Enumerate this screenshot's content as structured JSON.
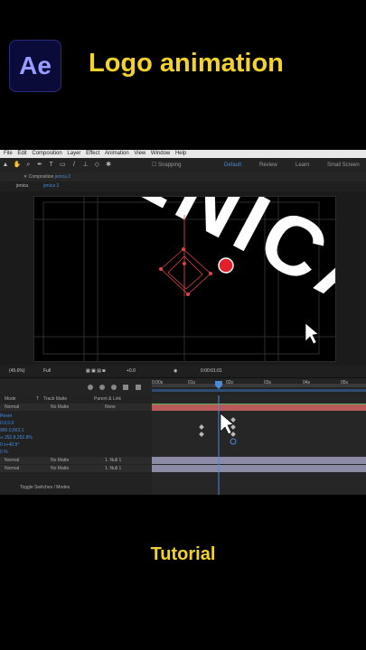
{
  "header": {
    "logo_text": "Ae",
    "title": "Logo animation"
  },
  "footer": {
    "label": "Tutorial"
  },
  "menu": [
    "File",
    "Edit",
    "Composition",
    "Layer",
    "Effect",
    "Animation",
    "View",
    "Window",
    "Help"
  ],
  "workspace": {
    "snapping": "Snapping",
    "default": "Default",
    "review": "Review",
    "learn": "Learn",
    "small_screen": "Small Screen"
  },
  "panel": {
    "title": "Composition",
    "comp_name": "jenica 2"
  },
  "tabs": [
    "jenica",
    "jenica 2"
  ],
  "viewer": {
    "artwork_text": "ENICA",
    "zoom": "(45.6%)",
    "resolution": "Full",
    "timecode": "0:00:01:01",
    "color_mode": "+0.0"
  },
  "timeline": {
    "ruler": [
      "0:00s",
      "01s",
      "02s",
      "03s",
      "04s",
      "05s"
    ],
    "columns": {
      "mode": "Mode",
      "t": "T",
      "track_matte": "Track Matte",
      "parent": "Parent & Link"
    },
    "rows": [
      {
        "mode": "Normal",
        "matte": "No Matte",
        "parent": "None"
      },
      {
        "label": "Reset"
      },
      {
        "value": "0.0,0.0"
      },
      {
        "value": "960.0,563.1"
      },
      {
        "value": "∞ 252.8,252.8%"
      },
      {
        "value": "0 x+40.9°"
      },
      {
        "value": "0 %"
      },
      {
        "mode": "Normal",
        "matte": "No Matte",
        "parent": "1. Null 1"
      },
      {
        "mode": "Normal",
        "matte": "No Matte",
        "parent": "1. Null 1"
      }
    ],
    "toggle_label": "Toggle Switches / Modes"
  },
  "colors": {
    "accent": "#f2d22e",
    "ae_bg": "#0b0b3a",
    "ae_text": "#9a9dff",
    "playhead": "#4a8bd6",
    "layer_bar": "#b85a5a"
  }
}
